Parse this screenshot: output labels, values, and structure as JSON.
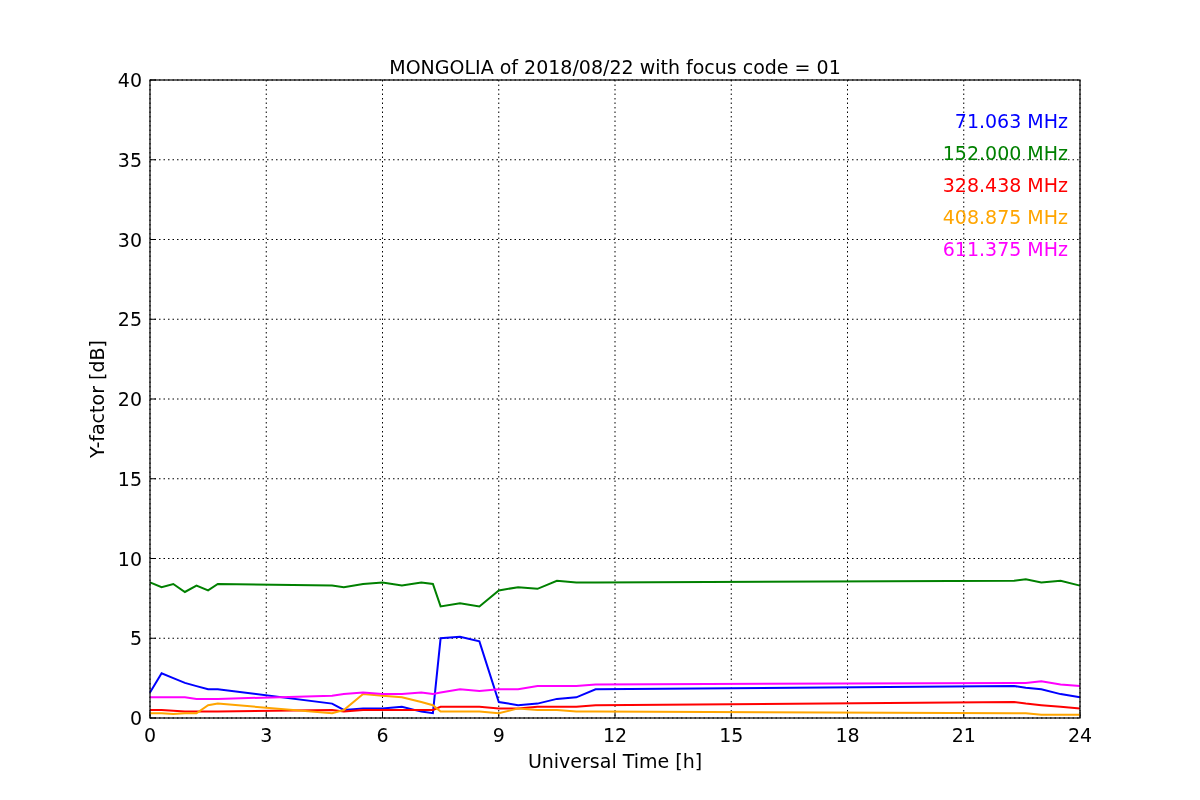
{
  "chart_data": {
    "type": "line",
    "title": "MONGOLIA of 2018/08/22 with focus code = 01",
    "xlabel": "Universal Time [h]",
    "ylabel": "Y-factor [dB]",
    "x": [
      0,
      0.3,
      0.6,
      0.9,
      1.2,
      1.5,
      1.75,
      4.7,
      5.0,
      5.5,
      6,
      6.5,
      7,
      7.3,
      7.5,
      8,
      8.5,
      9,
      9.5,
      10,
      10.5,
      11,
      11.5,
      22.3,
      22.6,
      23,
      23.5,
      24
    ],
    "series": [
      {
        "name": "71.063 MHz",
        "color": "#0000ff",
        "values": [
          1.6,
          2.8,
          2.5,
          2.2,
          2.0,
          1.8,
          1.8,
          0.9,
          0.5,
          0.6,
          0.6,
          0.7,
          0.4,
          0.3,
          5.0,
          5.1,
          4.8,
          1.0,
          0.8,
          0.9,
          1.2,
          1.3,
          1.8,
          2.0,
          1.9,
          1.8,
          1.5,
          1.3
        ]
      },
      {
        "name": "152.000 MHz",
        "color": "#008000",
        "values": [
          8.5,
          8.2,
          8.4,
          7.9,
          8.3,
          8.0,
          8.4,
          8.3,
          8.2,
          8.4,
          8.5,
          8.3,
          8.5,
          8.4,
          7.0,
          7.2,
          7.0,
          8.0,
          8.2,
          8.1,
          8.6,
          8.5,
          8.5,
          8.6,
          8.7,
          8.5,
          8.6,
          8.3
        ]
      },
      {
        "name": "328.438 MHz",
        "color": "#ff0000",
        "values": [
          0.5,
          0.5,
          0.45,
          0.4,
          0.4,
          0.4,
          0.4,
          0.5,
          0.4,
          0.5,
          0.5,
          0.5,
          0.5,
          0.5,
          0.7,
          0.7,
          0.7,
          0.6,
          0.6,
          0.7,
          0.7,
          0.7,
          0.8,
          1.0,
          0.9,
          0.8,
          0.7,
          0.6
        ]
      },
      {
        "name": "408.875 MHz",
        "color": "#ffa500",
        "values": [
          0.3,
          0.3,
          0.25,
          0.3,
          0.3,
          0.8,
          0.9,
          0.3,
          0.5,
          1.5,
          1.4,
          1.3,
          1.0,
          0.8,
          0.4,
          0.4,
          0.4,
          0.3,
          0.6,
          0.5,
          0.5,
          0.4,
          0.4,
          0.3,
          0.3,
          0.2,
          0.2,
          0.2
        ]
      },
      {
        "name": "611.375 MHz",
        "color": "#ff00ff",
        "values": [
          1.3,
          1.3,
          1.3,
          1.3,
          1.2,
          1.2,
          1.2,
          1.4,
          1.5,
          1.6,
          1.5,
          1.5,
          1.6,
          1.5,
          1.6,
          1.8,
          1.7,
          1.8,
          1.8,
          2.0,
          2.0,
          2.0,
          2.1,
          2.2,
          2.2,
          2.3,
          2.1,
          2.0
        ]
      }
    ],
    "xlim": [
      0,
      24
    ],
    "ylim": [
      0,
      40
    ],
    "xticks": [
      0,
      3,
      6,
      9,
      12,
      15,
      18,
      21,
      24
    ],
    "yticks": [
      0,
      5,
      10,
      15,
      20,
      25,
      30,
      35,
      40
    ],
    "grid": true
  }
}
